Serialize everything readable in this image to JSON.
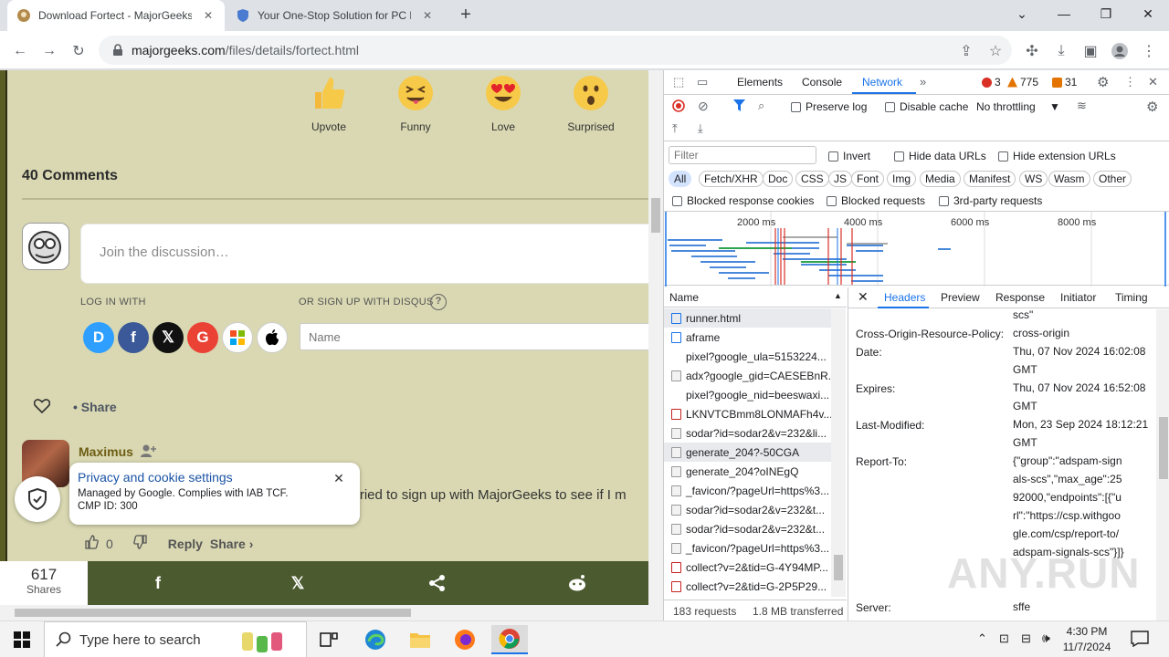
{
  "browser": {
    "tabs": [
      {
        "title": "Download Fortect - MajorGeeks",
        "active": true
      },
      {
        "title": "Your One-Stop Solution for PC R",
        "active": false
      }
    ],
    "url_host": "majorgeeks.com",
    "url_path": "/files/details/fortect.html"
  },
  "page": {
    "reactions": [
      {
        "label": "Upvote",
        "icon": "thumbs-up-emoji"
      },
      {
        "label": "Funny",
        "icon": "tongue-out-emoji"
      },
      {
        "label": "Love",
        "icon": "heart-eyes-emoji"
      },
      {
        "label": "Surprised",
        "icon": "surprised-emoji"
      }
    ],
    "comments_title": "40 Comments",
    "discussion_placeholder": "Join the discussion…",
    "log_in_with": "LOG IN WITH",
    "or_sign_up": "OR SIGN UP WITH DISQUS",
    "help": "?",
    "social": [
      {
        "name": "disqus",
        "glyph": "D",
        "color": "#2e9fff"
      },
      {
        "name": "facebook",
        "glyph": "f",
        "color": "#3b5998"
      },
      {
        "name": "x",
        "glyph": "𝕏",
        "color": "#111111"
      },
      {
        "name": "google",
        "glyph": "G",
        "color": "#ea4335"
      },
      {
        "name": "microsoft",
        "glyph": "",
        "color": "#ffffff"
      },
      {
        "name": "apple",
        "glyph": "",
        "color": "#000000"
      }
    ],
    "name_placeholder": "Name",
    "share": "Share",
    "comment": {
      "author": "Maximus",
      "text": ". I tried to sign up with MajorGeeks to see if I m",
      "votes": "0",
      "reply": "Reply",
      "share": "Share ›"
    },
    "cookie": {
      "title": "Privacy and cookie settings",
      "line1": "Managed by Google. Complies with IAB TCF.",
      "line2": "CMP ID: 300"
    },
    "sharebar": {
      "count": "617",
      "label": "Shares"
    }
  },
  "devtools": {
    "tabs": [
      "Elements",
      "Console",
      "Network"
    ],
    "active_tab": "Network",
    "errors": "3",
    "warnings": "775",
    "issues": "31",
    "preserve_log": "Preserve log",
    "disable_cache": "Disable cache",
    "throttling": "No throttling",
    "filter_placeholder": "Filter",
    "invert": "Invert",
    "hide_data_urls": "Hide data URLs",
    "hide_extension_urls": "Hide extension URLs",
    "types": [
      "All",
      "Fetch/XHR",
      "Doc",
      "CSS",
      "JS",
      "Font",
      "Img",
      "Media",
      "Manifest",
      "WS",
      "Wasm",
      "Other"
    ],
    "blocked_cookies": "Blocked response cookies",
    "blocked_requests": "Blocked requests",
    "third_party": "3rd-party requests",
    "ticks": [
      "2000 ms",
      "4000 ms",
      "6000 ms",
      "8000 ms"
    ],
    "name_col": "Name",
    "requests": [
      {
        "name": "runner.html",
        "kind": "doc",
        "selected": true
      },
      {
        "name": "aframe",
        "kind": "doc",
        "selected": false
      },
      {
        "name": "pixel?google_ula=5153224...",
        "kind": "none",
        "selected": false
      },
      {
        "name": "adx?google_gid=CAESEBnR...",
        "kind": "img",
        "selected": false
      },
      {
        "name": "pixel?google_nid=beeswaxi...",
        "kind": "none",
        "selected": false
      },
      {
        "name": "LKNVTCBmm8LONMAFh4v...",
        "kind": "red",
        "selected": false
      },
      {
        "name": "sodar?id=sodar2&v=232&li...",
        "kind": "img",
        "selected": false
      },
      {
        "name": "generate_204?-50CGA",
        "kind": "img",
        "selected": true
      },
      {
        "name": "generate_204?oINEgQ",
        "kind": "img",
        "selected": false
      },
      {
        "name": "_favicon/?pageUrl=https%3...",
        "kind": "img",
        "selected": false
      },
      {
        "name": "sodar?id=sodar2&v=232&t...",
        "kind": "img",
        "selected": false
      },
      {
        "name": "sodar?id=sodar2&v=232&t...",
        "kind": "img",
        "selected": false
      },
      {
        "name": "_favicon/?pageUrl=https%3...",
        "kind": "img",
        "selected": false
      },
      {
        "name": "collect?v=2&tid=G-4Y94MP...",
        "kind": "red",
        "selected": false
      },
      {
        "name": "collect?v=2&tid=G-2P5P29...",
        "kind": "red",
        "selected": false
      }
    ],
    "req_count": "183 requests",
    "transferred": "1.8 MB transferred",
    "detail_tabs": [
      "Headers",
      "Preview",
      "Response",
      "Initiator",
      "Timing"
    ],
    "active_detail_tab": "Headers",
    "headers": [
      {
        "key": "",
        "value": "scs\""
      },
      {
        "key": "Cross-Origin-Resource-Policy:",
        "value": "cross-origin"
      },
      {
        "key": "Date:",
        "value": "Thu, 07 Nov 2024 16:02:08 GMT"
      },
      {
        "key": "Expires:",
        "value": "Thu, 07 Nov 2024 16:52:08 GMT"
      },
      {
        "key": "Last-Modified:",
        "value": "Mon, 23 Sep 2024 18:12:21 GMT"
      },
      {
        "key": "Report-To:",
        "value": "{\"group\":\"adspam-signals-scs\",\"max_age\":2592000,\"endpoints\":[{\"url\":\"https://csp.withgoogle.com/csp/report-to/adspam-signals-scs\"}]}"
      },
      {
        "key": "Server:",
        "value": "sffe"
      }
    ]
  },
  "taskbar": {
    "search_placeholder": "Type here to search",
    "time": "4:30 PM",
    "date": "11/7/2024"
  },
  "watermark": "ANY.RUN"
}
